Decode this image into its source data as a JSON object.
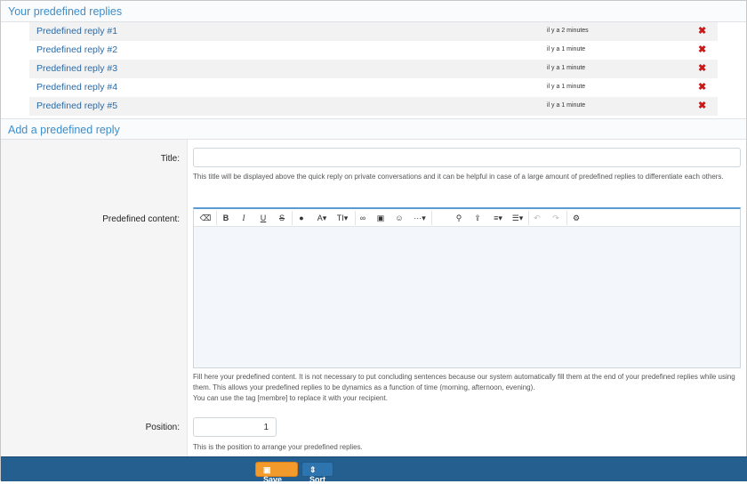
{
  "replies_section": {
    "title": "Your predefined replies"
  },
  "replies": [
    {
      "name": "Predefined reply #1",
      "time": "il y a 2 minutes"
    },
    {
      "name": "Predefined reply #2",
      "time": "il y a 1 minute"
    },
    {
      "name": "Predefined reply #3",
      "time": "il y a 1 minute"
    },
    {
      "name": "Predefined reply #4",
      "time": "il y a 1 minute"
    },
    {
      "name": "Predefined reply #5",
      "time": "il y a 1 minute"
    }
  ],
  "delete_icon": "close-icon",
  "add_section": {
    "title": "Add a predefined reply"
  },
  "form": {
    "title_label": "Title:",
    "title_value": "",
    "title_help": "This title will be displayed above the quick reply on private conversations and it can be helpful in case of a large amount of predefined replies to differentiate each others.",
    "content_label": "Predefined content:",
    "content_help_1": "Fill here your predefined content. It is not necessary to put concluding sentences because our system automatically fill them at the end of your predefined replies while using them. This allows your predefined replies to be dynamics as a function of time (morning, afternoon, evening).",
    "content_help_2": "You can use the tag [membre] to replace it with your recipient.",
    "position_label": "Position:",
    "position_value": "1",
    "position_help": "This is the position to arrange your predefined replies."
  },
  "toolbar": {
    "eraser": "⌫",
    "bold": "B",
    "italic": "I",
    "underline": "U",
    "strike": "S",
    "color": "●",
    "font": "A▾",
    "size": "TI▾",
    "link": "∞",
    "image": "▣",
    "emoji": "☺",
    "more": "···▾",
    "pin": "⚲",
    "upload": "⇪",
    "align": "≡▾",
    "list": "☰▾",
    "undo": "↶",
    "redo": "↷",
    "settings": "⚙"
  },
  "footer": {
    "save_label": "Save",
    "sort_label": "Sort"
  },
  "colors": {
    "accent": "#3d8ecb",
    "footer": "#245f8f",
    "save": "#f29b2c",
    "delete": "#c8191a"
  }
}
